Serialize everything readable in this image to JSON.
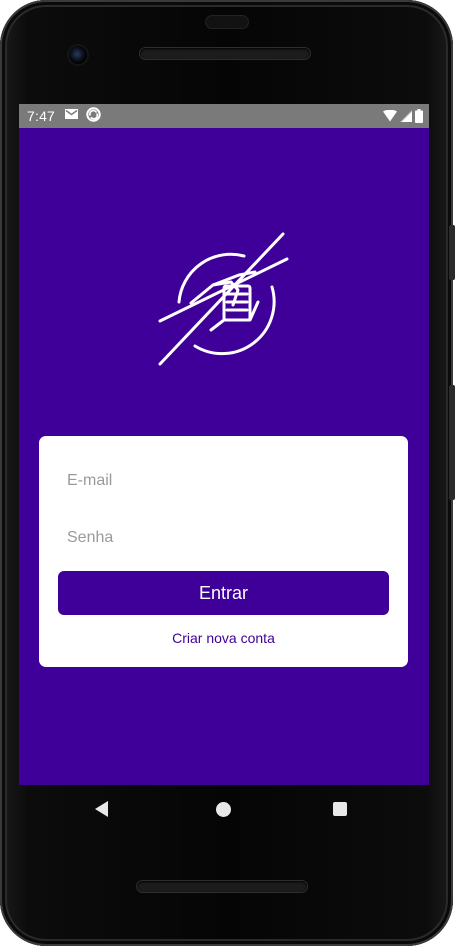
{
  "status_bar": {
    "time": "7:47",
    "icons": [
      "mail-icon",
      "sync-icon",
      "wifi-icon",
      "signal-icon",
      "battery-icon"
    ]
  },
  "app": {
    "logo_icon": "handshake-circle-icon",
    "colors": {
      "primary": "#3f0099",
      "card": "#ffffff",
      "placeholder": "#9a9a9a"
    }
  },
  "login": {
    "email_placeholder": "E-mail",
    "email_value": "",
    "password_placeholder": "Senha",
    "password_value": "",
    "enter_label": "Entrar",
    "create_account_label": "Criar nova conta"
  },
  "nav": {
    "icons": [
      "back-icon",
      "home-icon",
      "recents-icon"
    ]
  }
}
